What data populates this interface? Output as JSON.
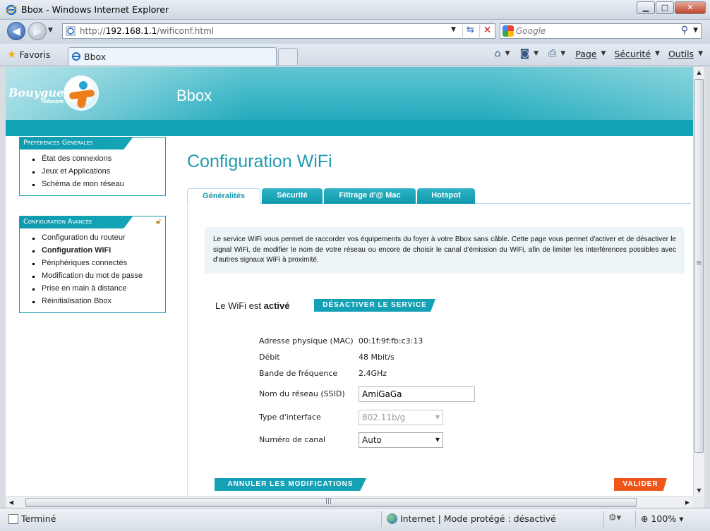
{
  "window": {
    "title": "Bbox - Windows Internet Explorer",
    "minimize": "▁",
    "maximize": "□",
    "close": "✕"
  },
  "toolbar": {
    "url_prefix": "http://",
    "url_host": "192.168.1.1",
    "url_path": "/wificonf.html",
    "search_placeholder": "Google",
    "favorites_label": "Favoris",
    "tab_label": "Bbox",
    "page_menu": "Page",
    "security_menu": "Sécurité",
    "tools_menu": "Outils"
  },
  "banner": {
    "logo_text": "Bouygues",
    "logo_sub": "Telecom",
    "title": "Bbox"
  },
  "sidebar": {
    "general": {
      "heading": "Préférences Générales",
      "items": [
        "État des connexions",
        "Jeux et Applications",
        "Schéma de mon réseau"
      ]
    },
    "advanced": {
      "heading": "Configuration Avancée",
      "items": [
        "Configuration du routeur",
        "Configuration WiFi",
        "Périphériques connectés",
        "Modification du mot de passe",
        "Prise en main à distance",
        "Réinitialisation Bbox"
      ],
      "active_index": 1
    }
  },
  "main": {
    "title": "Configuration WiFi",
    "tabs": [
      "Généralités",
      "Sécurité",
      "Filtrage d'@ Mac",
      "Hotspot"
    ],
    "selected_tab": 0,
    "info_text": "Le service WiFi vous permet de raccorder vos équipements du foyer à votre Bbox sans câble. Cette page vous permet d'activer et de désactiver le signal WiFi, de modifier le nom de votre réseau ou encore de choisir le canal d'émission du WiFi, afin de limiter les interférences possibles avec d'autres signaux WiFi à proximité.",
    "status_prefix": "Le WiFi est ",
    "status_value": "activé",
    "disable_button": "DÉSACTIVER LE SERVICE",
    "fields": {
      "mac_label": "Adresse physique (MAC)",
      "mac_value": "00:1f:9f:fb:c3:13",
      "rate_label": "Débit",
      "rate_value": "48 Mbit/s",
      "band_label": "Bande de fréquence",
      "band_value": "2.4GHz",
      "ssid_label": "Nom du réseau (SSID)",
      "ssid_value": "AmiGaGa",
      "iface_label": "Type d'interface",
      "iface_value": "802.11b/g",
      "channel_label": "Numéro de canal",
      "channel_value": "Auto"
    },
    "cancel_button": "ANNULER LES MODIFICATIONS",
    "validate_button": "VALIDER"
  },
  "status": {
    "text": "Terminé",
    "zone": "Internet | Mode protégé : désactivé",
    "zoom": "100%"
  }
}
